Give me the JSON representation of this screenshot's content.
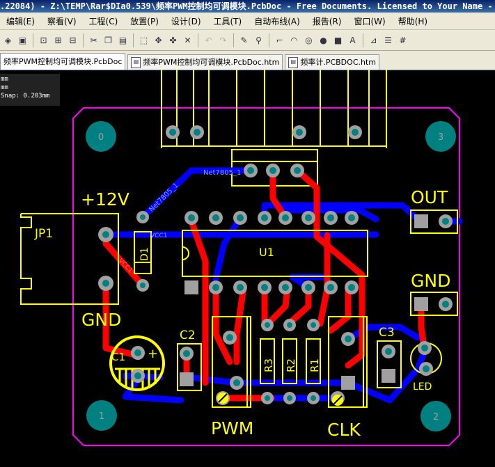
{
  "window": {
    "title": ".22084) - Z:\\TEMP\\Rar$DIa0.539\\频率PWM控制均可调模块.PcbDoc - Free Documents. Licensed to Your Name - S"
  },
  "menu": {
    "items": [
      "编辑(E)",
      "察看(V)",
      "工程(C)",
      "放置(P)",
      "设计(D)",
      "工具(T)",
      "自动布线(A)",
      "报告(R)",
      "窗口(W)",
      "帮助(H)"
    ]
  },
  "toolbar": {
    "buttons": [
      "layers-icon",
      "save-icon",
      "zoom-fit-icon",
      "zoom-area-icon",
      "zoom-select-icon",
      "cut-icon",
      "copy-icon",
      "paste-icon",
      "select-rect-icon",
      "move-icon",
      "cross-probe-icon",
      "deselect-icon",
      "undo-icon",
      "redo-icon",
      "pencil-icon",
      "search-icon",
      "route-icon",
      "arc-icon",
      "via-icon",
      "pad-icon",
      "fill-icon",
      "string-icon",
      "chart-icon",
      "align-icon",
      "grid-icon"
    ]
  },
  "tabs": [
    {
      "label": "频率PWM控制均可调模块.PcbDoc",
      "active": true
    },
    {
      "label": "频率PWM控制均可调模块.PcbDoc.htm",
      "active": false
    },
    {
      "label": "频率计.PCBDOC.htm",
      "active": false
    }
  ],
  "info_panel": {
    "line1": "mm",
    "line2": "mm",
    "line3": "Snap: 0.203mm"
  },
  "pcb": {
    "labels": {
      "power": "+12V",
      "jp1": "JP1",
      "gnd_left": "GND",
      "out": "OUT",
      "gnd_right": "GND",
      "u1": "U1",
      "d1": "D1",
      "c1": "C1",
      "c1_plus": "+",
      "c2": "C2",
      "c3": "C3",
      "r1": "R1",
      "r2": "R2",
      "r3": "R3",
      "led": "LED",
      "pwm": "PWM",
      "clk": "CLK",
      "mount0": "0",
      "mount1": "1",
      "mount2": "2",
      "mount3": "3",
      "net7805": "Net7805_1",
      "net7805_b": "Net7805_1",
      "vcc1_a": "VCC1",
      "vcc1_b": "VCC1"
    },
    "colors": {
      "board_outline": "#ff00ff",
      "silkscreen": "#ffff00",
      "top_layer": "#ff0000",
      "bottom_layer": "#0000ff",
      "pad": "#a0a0a0",
      "hole": "#008080",
      "background": "#000000"
    }
  }
}
